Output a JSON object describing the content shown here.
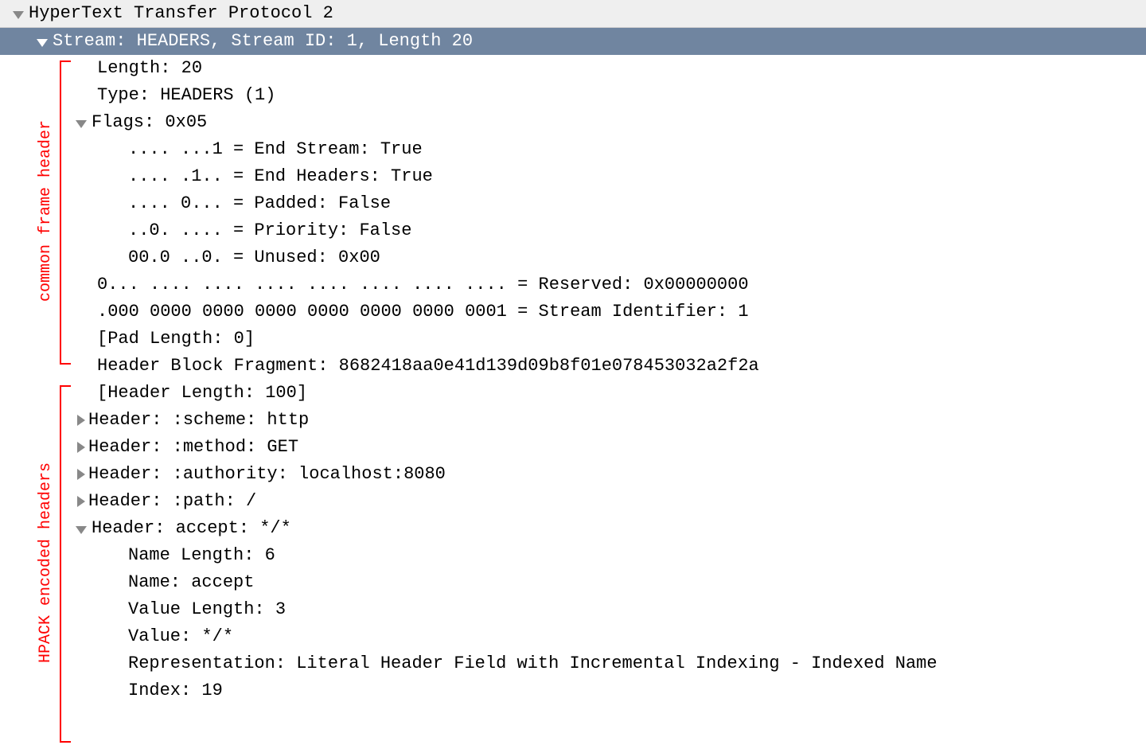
{
  "root": {
    "title": "HyperText Transfer Protocol 2"
  },
  "stream": {
    "title": "Stream: HEADERS, Stream ID: 1, Length 20"
  },
  "frame": {
    "length": "Length: 20",
    "type": "Type: HEADERS (1)",
    "flags": "Flags: 0x05",
    "flag_endstream": ".... ...1 = End Stream: True",
    "flag_endheaders": ".... .1.. = End Headers: True",
    "flag_padded": ".... 0... = Padded: False",
    "flag_priority": "..0. .... = Priority: False",
    "flag_unused": "00.0 ..0. = Unused: 0x00",
    "reserved": "0... .... .... .... .... .... .... .... = Reserved: 0x00000000",
    "streamid": ".000 0000 0000 0000 0000 0000 0000 0001 = Stream Identifier: 1",
    "padlen": "[Pad Length: 0]"
  },
  "hbf": "Header Block Fragment: 8682418aa0e41d139d09b8f01e078453032a2f2a",
  "hpack": {
    "hlen": "[Header Length: 100]",
    "h1": "Header: :scheme: http",
    "h2": "Header: :method: GET",
    "h3": "Header: :authority: localhost:8080",
    "h4": "Header: :path: /",
    "h5": "Header: accept: */*",
    "nlen": "Name Length: 6",
    "name": "Name: accept",
    "vlen": "Value Length: 3",
    "value": "Value: */*",
    "repr": "Representation: Literal Header Field with Incremental Indexing - Indexed Name",
    "idx": "Index: 19"
  },
  "annotations": {
    "common": "common frame header",
    "hpack": "HPACK encoded headers"
  }
}
